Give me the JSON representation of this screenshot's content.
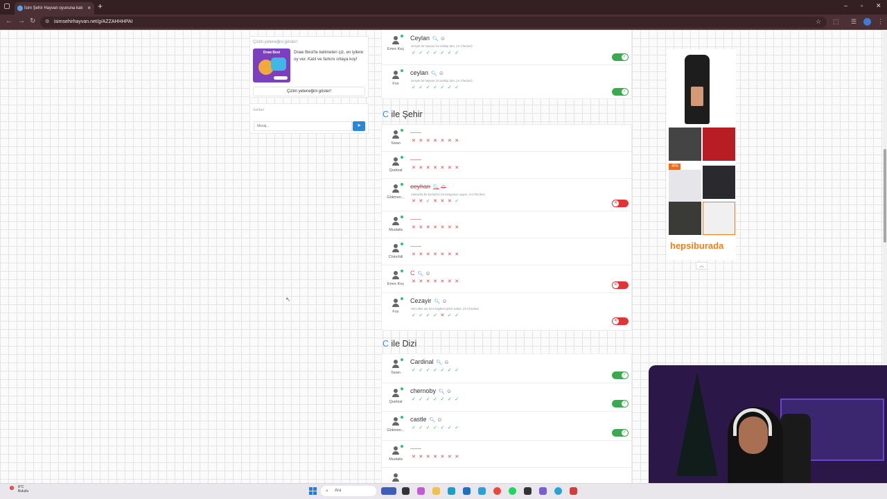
{
  "browser": {
    "tab_title": "İsim Şehir Hayvan oyununa katı",
    "tab_close": "×",
    "new_tab": "+",
    "url": "isimsehirhayvan.net/g/AZZAHHHPAI",
    "minimize": "–",
    "maximize": "▫",
    "close": "✕"
  },
  "draw_promo": {
    "title": "Çizim yeteneğini göster!",
    "image_brand": "Draw Best",
    "description": "Draw Best'te kelimeleri çiz, en iyilere oy ver. Katıl ve farkını ortaya koy!",
    "button_label": "Çizim yeteneğini göster!"
  },
  "chat": {
    "title": "Sohbet",
    "input_placeholder": "Mesaj...",
    "send_icon": "send-icon"
  },
  "sections": {
    "hayvan_rows": [
      {
        "player": "Emre Koç",
        "answer": "Ceylan",
        "note": "Gerçek bir hayvan; bir antilop türü. (AI Checker)",
        "votes": [
          "ok",
          "ok",
          "ok",
          "ok",
          "ok",
          "ok",
          "ok"
        ],
        "accepted": true
      },
      {
        "player": "Fox",
        "answer": "ceylan",
        "note": "Gerçek bir hayvan; bir antilop türü. (AI Checker)",
        "votes": [
          "ok",
          "ok",
          "ok",
          "ok",
          "ok",
          "ok",
          "ok"
        ],
        "accepted": true
      }
    ],
    "sehir": {
      "letter": "C",
      "title": "ile Şehir",
      "rows": [
        {
          "player": "Swan",
          "answer": "",
          "note": "",
          "votes": [
            "no",
            "no",
            "no",
            "no",
            "no",
            "no",
            "no"
          ],
          "toggle": null
        },
        {
          "player": "Quetzal",
          "answer": "",
          "note": "",
          "votes": [
            "no",
            "no",
            "no",
            "no",
            "no",
            "no",
            "no"
          ],
          "toggle": null
        },
        {
          "player": "Gökmen...",
          "answer": "ceyhan",
          "note": "Adana'da bir ilçe/şehir; bu kategoriye uygun. (AI Checker)",
          "votes": [
            "no",
            "no",
            "ok",
            "no",
            "no",
            "no",
            "ok"
          ],
          "toggle": false
        },
        {
          "player": "Mustafa",
          "answer": "",
          "note": "",
          "votes": [
            "no",
            "no",
            "no",
            "no",
            "no",
            "no",
            "no"
          ],
          "toggle": null
        },
        {
          "player": "Chinchili",
          "answer": "",
          "note": "",
          "votes": [
            "no",
            "no",
            "no",
            "no",
            "no",
            "no",
            "no"
          ],
          "toggle": null
        },
        {
          "player": "Emre Koç",
          "answer": "C",
          "note": "",
          "votes": [
            "no",
            "no",
            "no",
            "no",
            "no",
            "no",
            "no"
          ],
          "toggle": false
        },
        {
          "player": "Fox",
          "answer": "Cezayir",
          "note": "Hem ülke adı hem başkent şehir; kabul. (AI Checker)",
          "votes": [
            "ok",
            "ok",
            "ok",
            "ok",
            "no",
            "ok",
            "ok"
          ],
          "toggle": false
        }
      ]
    },
    "dizi": {
      "letter": "C",
      "title": "ile Dizi",
      "rows": [
        {
          "player": "Swan",
          "answer": "Cardinal",
          "votes": [
            "ok",
            "ok",
            "ok",
            "ok",
            "ok",
            "ok",
            "ok"
          ],
          "toggle": true
        },
        {
          "player": "Quetzal",
          "answer": "chernoby",
          "votes": [
            "ok",
            "ok",
            "ok",
            "ok",
            "ok",
            "ok",
            "ok"
          ],
          "toggle": true
        },
        {
          "player": "Gökmen...",
          "answer": "castle",
          "votes": [
            "ok",
            "ok",
            "ok",
            "ok",
            "ok",
            "ok",
            "ok"
          ],
          "toggle": true
        },
        {
          "player": "Mustafa",
          "answer": "",
          "votes": [
            "no",
            "no",
            "no",
            "no",
            "no",
            "no",
            "no"
          ],
          "toggle": null
        },
        {
          "player": "",
          "answer": "",
          "votes": [],
          "toggle": null
        }
      ]
    }
  },
  "ad": {
    "discount_badge": "-6%",
    "brand": "hepsiburada",
    "collapse_icon": "chevron-up-icon"
  },
  "taskbar": {
    "temperature": "8°C",
    "weather_desc": "Bulutlu",
    "notification_count": "1",
    "search_placeholder": "Ara"
  }
}
